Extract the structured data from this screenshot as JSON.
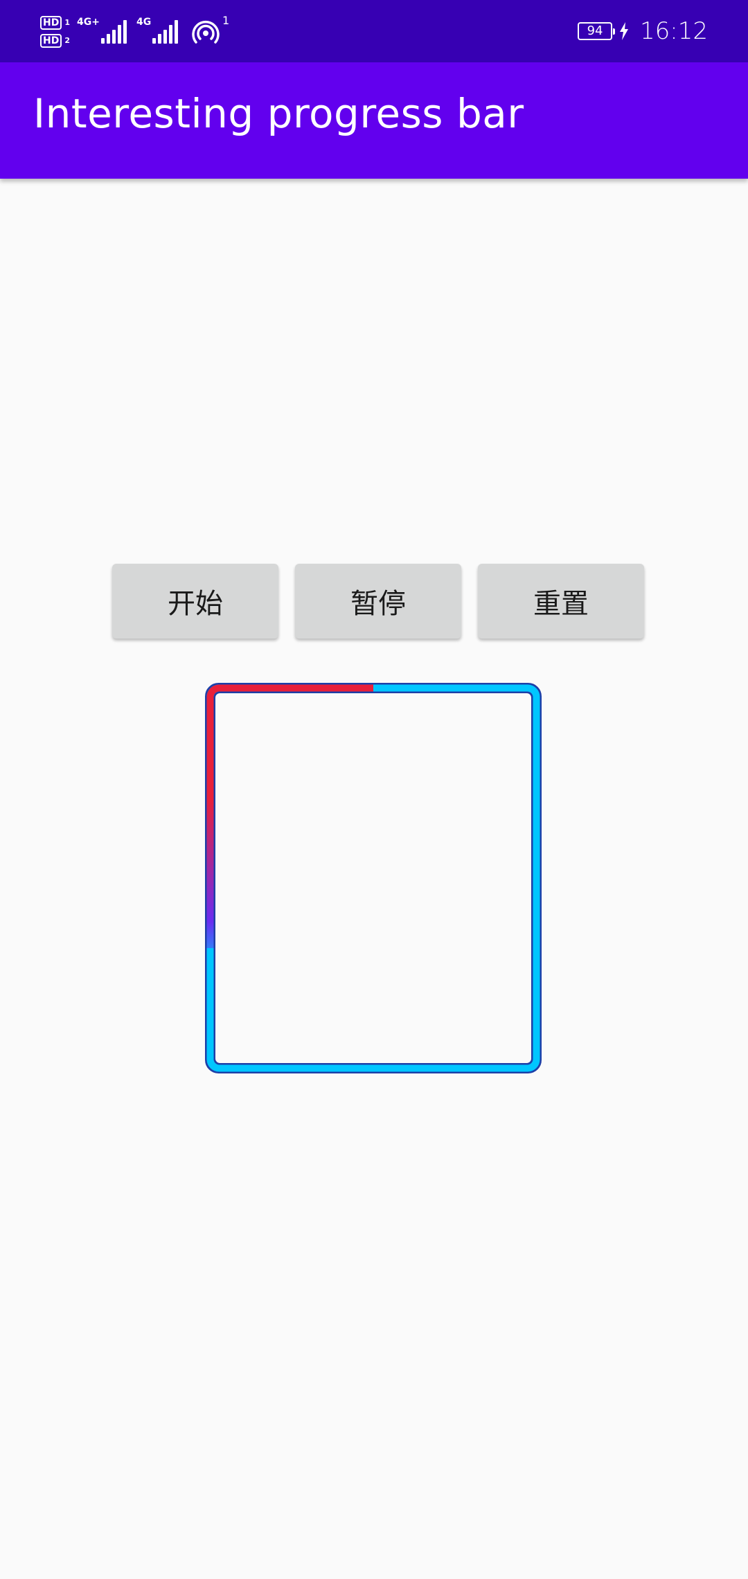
{
  "status_bar": {
    "hd1": "HD",
    "hd1_slot": "1",
    "hd2": "HD",
    "hd2_slot": "2",
    "net1": "4G+",
    "net2": "4G",
    "hotspot_count": "1",
    "battery": "94",
    "time": "16:12",
    "icons": [
      "hd-icon",
      "signal-icon",
      "hotspot-icon",
      "battery-icon",
      "charging-icon"
    ]
  },
  "app_bar": {
    "title": "Interesting progress bar",
    "color": "#6200ee"
  },
  "controls": {
    "start_label": "开始",
    "pause_label": "暂停",
    "reset_label": "重置"
  },
  "progress": {
    "value": 0.3,
    "track_color": "#00c6ff",
    "start_color": "#e8203a",
    "end_color": "#6a2cf0",
    "outline_color": "#1d3fa8"
  },
  "colors": {
    "status_bar": "#3700b3",
    "background": "#fafafa",
    "button": "#d6d7d7"
  }
}
